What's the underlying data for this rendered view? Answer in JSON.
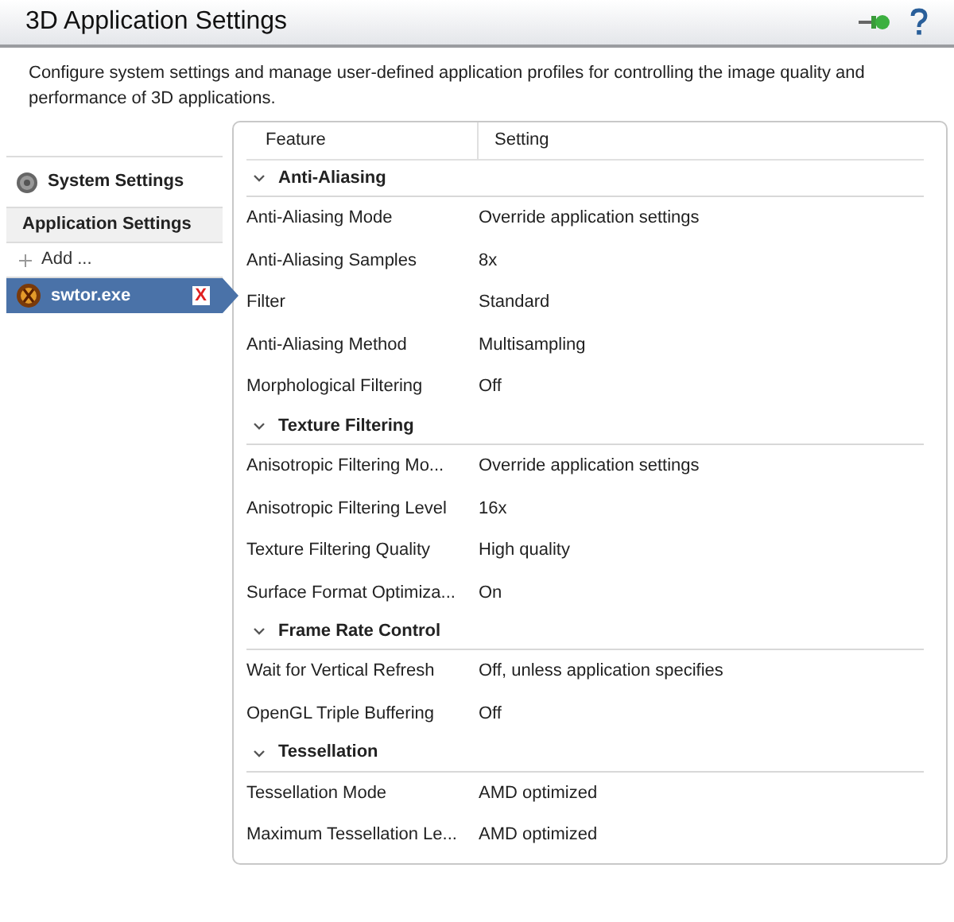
{
  "header": {
    "title": "3D Application Settings"
  },
  "description": "Configure system settings and manage user-defined application profiles for controlling the image quality and performance of 3D applications.",
  "sidebar": {
    "items": [
      {
        "kind": "system",
        "label": "System Settings",
        "selected": false
      },
      {
        "kind": "section",
        "label": "Application Settings"
      },
      {
        "kind": "add",
        "label": "Add ...",
        "selected": false
      },
      {
        "kind": "app",
        "label": "swtor.exe",
        "selected": true,
        "remove": "X"
      }
    ]
  },
  "table": {
    "columns": [
      "Feature",
      "Setting"
    ],
    "groups": [
      {
        "name": "Anti-Aliasing",
        "expanded": true,
        "rows": [
          {
            "feature": "Anti-Aliasing Mode",
            "setting": "Override application settings"
          },
          {
            "feature": "Anti-Aliasing Samples",
            "setting": "8x"
          },
          {
            "feature": "Filter",
            "setting": "Standard"
          },
          {
            "feature": "Anti-Aliasing Method",
            "setting": "Multisampling"
          },
          {
            "feature": "Morphological Filtering",
            "setting": "Off"
          }
        ]
      },
      {
        "name": "Texture Filtering",
        "expanded": true,
        "rows": [
          {
            "feature": "Anisotropic Filtering Mo...",
            "setting": "Override application settings"
          },
          {
            "feature": "Anisotropic Filtering Level",
            "setting": "16x"
          },
          {
            "feature": "Texture Filtering Quality",
            "setting": "High quality"
          },
          {
            "feature": "Surface Format Optimiza...",
            "setting": "On"
          }
        ]
      },
      {
        "name": "Frame Rate Control",
        "expanded": true,
        "rows": [
          {
            "feature": "Wait for Vertical Refresh",
            "setting": "Off, unless application specifies"
          },
          {
            "feature": "OpenGL Triple Buffering",
            "setting": "Off"
          }
        ]
      },
      {
        "name": "Tessellation",
        "expanded": true,
        "rows": [
          {
            "feature": "Tessellation Mode",
            "setting": "AMD optimized"
          },
          {
            "feature": "Maximum Tessellation Le...",
            "setting": "AMD optimized"
          }
        ]
      }
    ]
  }
}
